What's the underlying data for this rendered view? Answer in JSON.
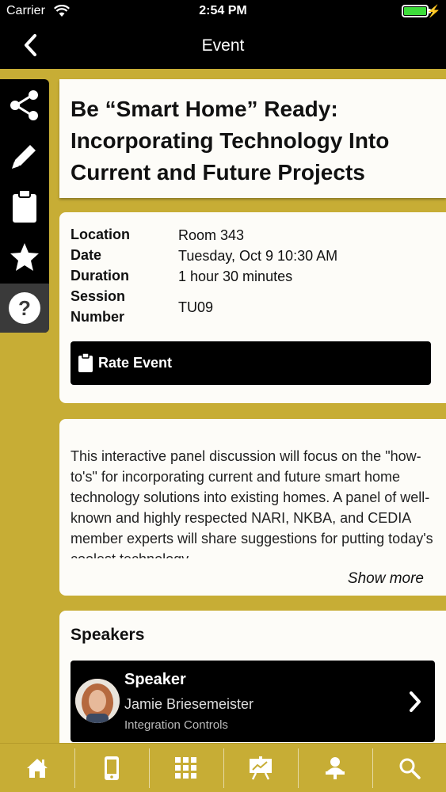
{
  "status_bar": {
    "carrier": "Carrier",
    "time": "2:54 PM",
    "battery_level": 1.0
  },
  "nav": {
    "title": "Event"
  },
  "rail": {
    "items": [
      {
        "icon": "share-icon"
      },
      {
        "icon": "pencil-icon"
      },
      {
        "icon": "clipboard-icon"
      },
      {
        "icon": "star-icon"
      },
      {
        "icon": "help-icon"
      }
    ]
  },
  "event": {
    "title": "Be “Smart Home” Ready: Incorporating Technology Into Current and Future Projects",
    "details": {
      "location_label": "Location",
      "location_value": "Room 343",
      "date_label": "Date",
      "date_value": "Tuesday, Oct 9 10:30 AM",
      "duration_label": "Duration",
      "duration_value": "1 hour 30 minutes",
      "session_label_1": "Session",
      "session_label_2": "Number",
      "session_value": "TU09"
    },
    "rate_button_label": "Rate Event",
    "description": "This interactive panel discussion will focus on the \"how-to's\" for incorporating current and future smart home technology solutions into existing homes. A panel of well-known and highly respected NARI, NKBA, and CEDIA member experts will share suggestions for putting today's coolest technology",
    "show_more_label": "Show more"
  },
  "speakers": {
    "heading": "Speakers",
    "items": [
      {
        "role": "Speaker",
        "name": "Jamie Briesemeister",
        "company": "Integration Controls"
      }
    ]
  },
  "tabbar": {
    "tabs": [
      {
        "icon": "home-icon"
      },
      {
        "icon": "mobile-icon"
      },
      {
        "icon": "qr-grid-icon"
      },
      {
        "icon": "presentation-icon"
      },
      {
        "icon": "exhibitor-icon"
      },
      {
        "icon": "search-icon"
      }
    ]
  },
  "colors": {
    "accent": "#c7ad35",
    "bar": "#000000",
    "card": "#fdfcf8",
    "battery": "#3ddc3a"
  }
}
